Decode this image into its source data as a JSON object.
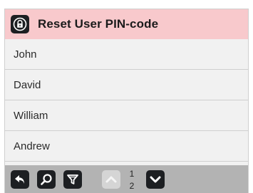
{
  "header": {
    "title": "Reset User PIN-code",
    "icon": "lock-shield-icon",
    "background": "#f8c9cc"
  },
  "users": [
    {
      "name": "John"
    },
    {
      "name": "David"
    },
    {
      "name": "William"
    },
    {
      "name": "Andrew"
    }
  ],
  "toolbar": {
    "buttons": [
      {
        "icon": "back-icon",
        "enabled": true
      },
      {
        "icon": "search-icon",
        "enabled": true
      },
      {
        "icon": "filter-icon",
        "enabled": true
      },
      {
        "icon": "page-up-icon",
        "enabled": false
      },
      {
        "icon": "page-down-icon",
        "enabled": true
      }
    ],
    "page": {
      "current": "1",
      "total": "2"
    }
  }
}
